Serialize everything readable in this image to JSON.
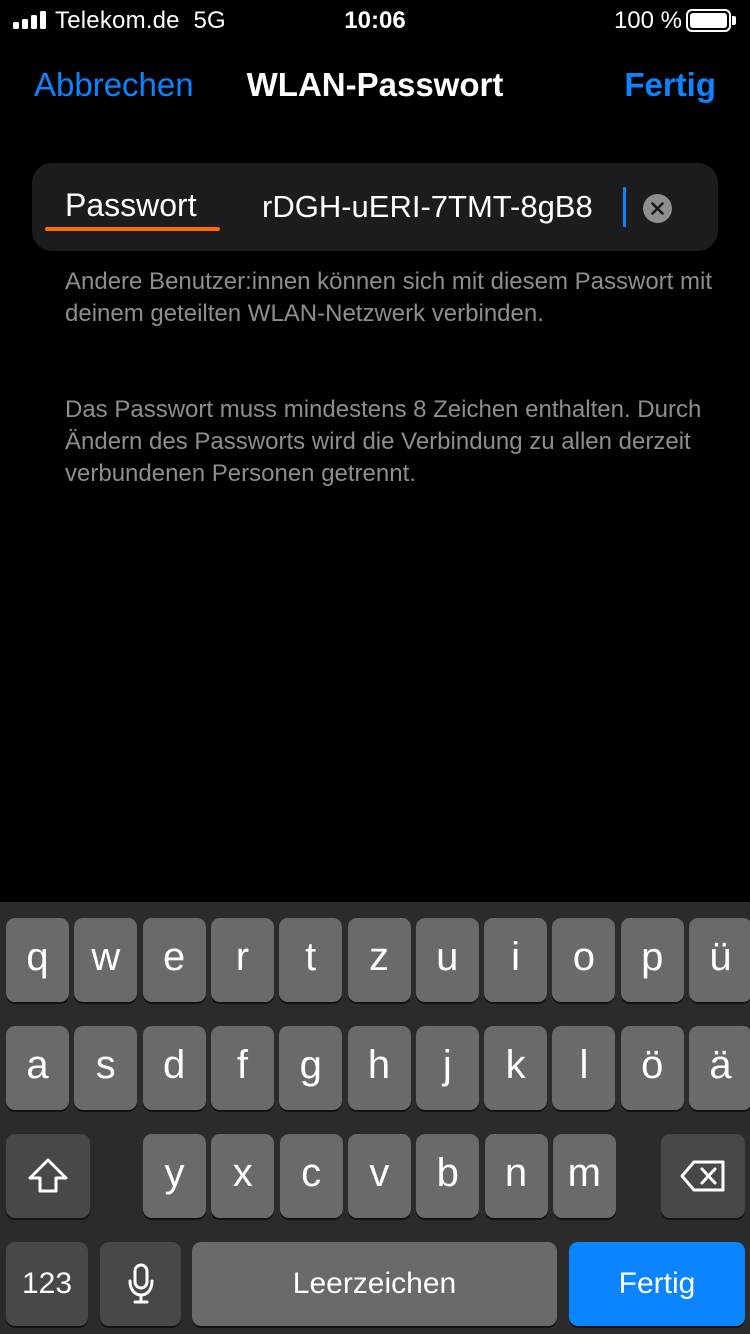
{
  "status_bar": {
    "carrier": "Telekom.de",
    "network": "5G",
    "time": "10:06",
    "battery_percent": "100 %",
    "battery_level": 1.0
  },
  "nav": {
    "cancel_label": "Abbrechen",
    "title": "WLAN-Passwort",
    "done_label": "Fertig"
  },
  "field": {
    "label": "Passwort",
    "value": "rDGH-uERI-7TMT-8gB8"
  },
  "notes": [
    "Andere Benutzer:innen können sich mit diesem Passwort mit deinem geteilten WLAN-Netzwerk verbinden.",
    "Das Passwort muss mindestens 8 Zeichen enthalten. Durch Ändern des Passworts wird die Verbindung zu allen derzeit verbundenen Personen getrennt."
  ],
  "keyboard": {
    "row1": [
      "q",
      "w",
      "e",
      "r",
      "t",
      "z",
      "u",
      "i",
      "o",
      "p",
      "ü"
    ],
    "row2": [
      "a",
      "s",
      "d",
      "f",
      "g",
      "h",
      "j",
      "k",
      "l",
      "ö",
      "ä"
    ],
    "row3": [
      "y",
      "x",
      "c",
      "v",
      "b",
      "n",
      "m"
    ],
    "numbers_label": "123",
    "space_label": "Leerzeichen",
    "return_label": "Fertig",
    "shift_icon": "shift-arrow-icon",
    "delete_icon": "backspace-icon",
    "mic_icon": "microphone-icon"
  },
  "colors": {
    "accent": "#0a84ff",
    "highlight_underline": "#ff6b00",
    "background": "#000000",
    "card": "#1c1c1e",
    "note_text": "#8d8d93"
  }
}
